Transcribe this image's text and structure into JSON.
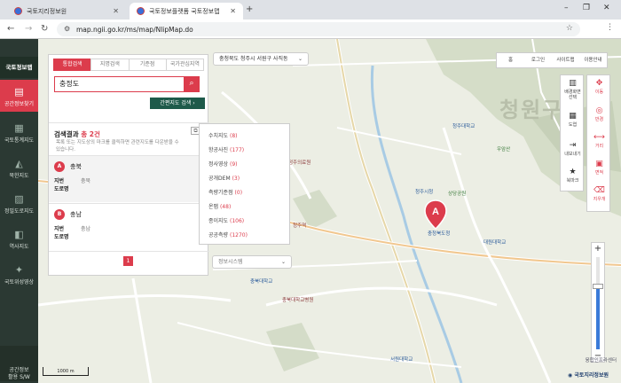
{
  "browser": {
    "tabs": [
      {
        "title": "국토지리정보원",
        "active": false
      },
      {
        "title": "국토정보플랫폼 국토정보맵",
        "active": true
      }
    ],
    "url": "map.ngii.go.kr/ms/map/NlipMap.do",
    "window_controls": [
      "–",
      "❐",
      "✕"
    ]
  },
  "left_nav": {
    "items": [
      {
        "label": "국토정보맵",
        "active": false,
        "top": true
      },
      {
        "label": "공간정보찾기",
        "active": true
      },
      {
        "label": "국토통계지도",
        "active": false
      },
      {
        "label": "북한지도",
        "active": false
      },
      {
        "label": "정밀도로지도",
        "active": false
      },
      {
        "label": "역사지도",
        "active": false
      },
      {
        "label": "국토위성영상",
        "active": false
      },
      {
        "label": "공간정보\n활용 S/W",
        "active": false
      }
    ]
  },
  "search_panel": {
    "tabs": [
      "통합검색",
      "지명검색",
      "기준점",
      "국가관심지역"
    ],
    "query": "충정도",
    "quick_button": "간편지도 검색",
    "result_title": "검색결과",
    "result_count_prefix": "총",
    "result_count": "2건",
    "result_desc": "목록 또는 지도상의 마크를 클릭하면 관련지도를 다운받을 수 있습니다.",
    "results": [
      {
        "marker": "A",
        "name": "충북",
        "fields": [
          {
            "label": "지번",
            "value": "충북"
          },
          {
            "label": "도로명",
            "value": ""
          }
        ]
      },
      {
        "marker": "B",
        "name": "충남",
        "fields": [
          {
            "label": "지번",
            "value": "충남"
          },
          {
            "label": "도로명",
            "value": ""
          }
        ]
      }
    ],
    "page": "1"
  },
  "location_dropdown": "충청북도 청주시 서원구 사직동",
  "layer_menu": [
    {
      "name": "수치지도",
      "count": "(8)"
    },
    {
      "name": "항공사진",
      "count": "(177)"
    },
    {
      "name": "정사영상",
      "count": "(9)"
    },
    {
      "name": "공개DEM",
      "count": "(3)"
    },
    {
      "name": "측량기준점",
      "count": "(0)"
    },
    {
      "name": "온맵",
      "count": "(48)"
    },
    {
      "name": "종이지도",
      "count": "(106)"
    },
    {
      "name": "공공측량",
      "count": "(1270)"
    }
  ],
  "info_dropdown": "정보시스템",
  "top_links": [
    "홈",
    "로그인",
    "사이트맵",
    "이용안내"
  ],
  "tools_left": [
    {
      "label": "배경화면\n선택",
      "icon": "map-icon"
    },
    {
      "label": "도엽",
      "icon": "grid-icon"
    },
    {
      "label": "내보내기",
      "icon": "export-icon"
    },
    {
      "label": "북마크",
      "icon": "star-icon"
    }
  ],
  "tools_right": [
    {
      "label": "이동",
      "icon": "move-icon"
    },
    {
      "label": "반경",
      "icon": "radius-icon"
    },
    {
      "label": "거리",
      "icon": "ruler-icon"
    },
    {
      "label": "면적",
      "icon": "area-icon"
    },
    {
      "label": "지우개",
      "icon": "eraser-icon"
    }
  ],
  "zoom": {
    "plus": "+",
    "minus": "−",
    "level_fraction": 0.68
  },
  "scale_bar": "1000 m",
  "copyright": "융합인프라센터",
  "provider_logo": "국토지리정보원",
  "map_marker": "A",
  "map_labels": [
    {
      "text": "청원구",
      "kind": "district"
    },
    {
      "text": "충청북도청",
      "kind": "b"
    },
    {
      "text": "청주시청",
      "kind": "b"
    },
    {
      "text": "청주대학교",
      "kind": "b"
    },
    {
      "text": "서원대학교",
      "kind": "b"
    },
    {
      "text": "충북대학교",
      "kind": "b"
    },
    {
      "text": "충북대학교병원",
      "kind": "r"
    },
    {
      "text": "대원대학교",
      "kind": "b"
    },
    {
      "text": "청주의료원",
      "kind": "r"
    },
    {
      "text": "우암산",
      "kind": "g"
    },
    {
      "text": "상당공원",
      "kind": "g"
    },
    {
      "text": "청주역",
      "kind": "r"
    }
  ],
  "colors": {
    "accent": "#dc3c4c",
    "nav_bg": "#2b3933",
    "quick_btn": "#1e5a4a",
    "zoom_fill": "#3a7ad8"
  }
}
